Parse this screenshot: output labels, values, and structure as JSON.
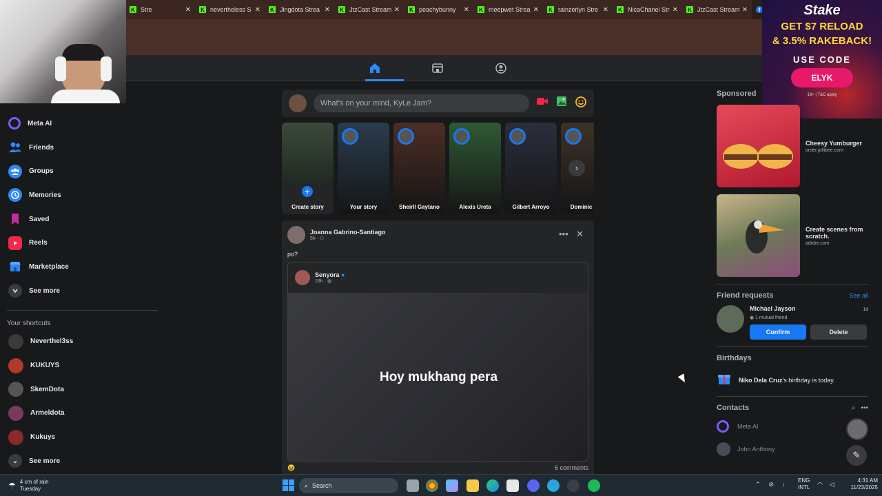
{
  "browser": {
    "tabs": [
      {
        "label": "Stre",
        "icon": "kick-icon"
      },
      {
        "label": "nevertheless S",
        "icon": "kick-icon"
      },
      {
        "label": "Jingdota Strea",
        "icon": "kick-icon"
      },
      {
        "label": "JtzCast Stream",
        "icon": "kick-icon"
      },
      {
        "label": "peachybunny",
        "icon": "kick-icon"
      },
      {
        "label": "meepwet Strea",
        "icon": "kick-icon"
      },
      {
        "label": "rainzerlyn Stre",
        "icon": "kick-icon"
      },
      {
        "label": "NicaChanel Str",
        "icon": "kick-icon"
      },
      {
        "label": "JtzCast Stream",
        "icon": "kick-icon"
      },
      {
        "label": "Facebook",
        "icon": "facebook-icon",
        "active": true
      }
    ]
  },
  "ad_banner": {
    "brand": "Stake",
    "promo_line1": "GET $7 RELOAD",
    "promo_line2": "& 3.5% RAKEBACK!",
    "code_label": "USE CODE",
    "code": "ELYK",
    "fine_print": "18+ | T&C apply"
  },
  "sidebar": {
    "items": [
      {
        "label": "Meta AI",
        "icon": "meta-ai-icon"
      },
      {
        "label": "Friends",
        "icon": "friends-icon"
      },
      {
        "label": "Groups",
        "icon": "groups-icon"
      },
      {
        "label": "Memories",
        "icon": "memories-icon"
      },
      {
        "label": "Saved",
        "icon": "saved-icon"
      },
      {
        "label": "Reels",
        "icon": "reels-icon"
      },
      {
        "label": "Marketplace",
        "icon": "marketplace-icon"
      },
      {
        "label": "See more",
        "icon": "chevron-down-icon"
      }
    ],
    "shortcuts_title": "Your shortcuts",
    "shortcuts": [
      {
        "label": "Neverthel3ss"
      },
      {
        "label": "KUKUYS"
      },
      {
        "label": "SkemDota"
      },
      {
        "label": "Armeldota"
      },
      {
        "label": "Kukuys"
      },
      {
        "label": "See more"
      }
    ]
  },
  "composer": {
    "placeholder": "What's on your mind, KyLe Jam?"
  },
  "stories": [
    {
      "name": "Create story",
      "color": "#2c3a2c"
    },
    {
      "name": "Your story",
      "color": "#2a3c4e"
    },
    {
      "name": "Sheirll Gaytano",
      "color": "#4d2d25"
    },
    {
      "name": "Alexis Ureta",
      "color": "#2f5a34"
    },
    {
      "name": "Gilbert Arroyo",
      "color": "#2b2e3c"
    },
    {
      "name": "Dominic Tua",
      "color": "#3d3228"
    }
  ],
  "post": {
    "author": "Joanna Gabrino-Santiago",
    "time": "5h ·",
    "text": "po?",
    "shared": {
      "author": "Senyora",
      "time": "19h ·",
      "body": "Hoy mukhang pera"
    },
    "comments": "6 comments"
  },
  "right": {
    "sponsored_title": "Sponsored",
    "ads": [
      {
        "title": "Cheesy Yumburger",
        "source": "order.jollibee.com",
        "color": "#c8283a"
      },
      {
        "title": "Create scenes from scratch.",
        "source": "adobe.com",
        "color": "#6e7a58"
      }
    ],
    "friend_requests": {
      "title": "Friend requests",
      "see_all": "See all",
      "name": "Michael Jayson",
      "age": "1d",
      "mutual": "1 mutual friend",
      "confirm": "Confirm",
      "delete": "Delete"
    },
    "birthdays": {
      "title": "Birthdays",
      "name": "Niko Dela Cruz",
      "text": "'s birthday is today."
    },
    "contacts": {
      "title": "Contacts",
      "items": [
        {
          "name": "Meta AI"
        },
        {
          "name": "John Anthony"
        }
      ]
    }
  },
  "taskbar": {
    "weather_line1": "4 cm of rain",
    "weather_line2": "Tuesday",
    "search": "Search",
    "lang1": "ENG",
    "lang2": "INTL",
    "time": "4:31 AM",
    "date": "11/23/2025"
  },
  "colors": {
    "accent": "#1877f2",
    "kick": "#53fc18"
  }
}
